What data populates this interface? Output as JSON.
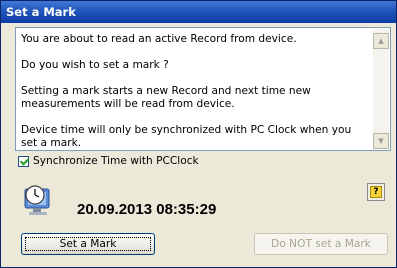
{
  "window": {
    "title": "Set a Mark"
  },
  "message": {
    "lines": [
      "You are about to read an active Record from device.",
      "Do you wish to set a mark ?",
      "Setting a mark starts a new Record and next time new measurements will be read from device.",
      "Device time will only be synchronized with PC Clock when you set a mark."
    ]
  },
  "sync": {
    "label": "Synchronize Time with PCClock",
    "checked": true
  },
  "clock": {
    "icon": "pc-clock-icon",
    "datetime": "20.09.2013 08:35:29"
  },
  "help": {
    "icon": "help-icon",
    "glyph": "?"
  },
  "buttons": {
    "set_mark": "Set a Mark",
    "do_not_set_mark": "Do NOT set a Mark"
  }
}
